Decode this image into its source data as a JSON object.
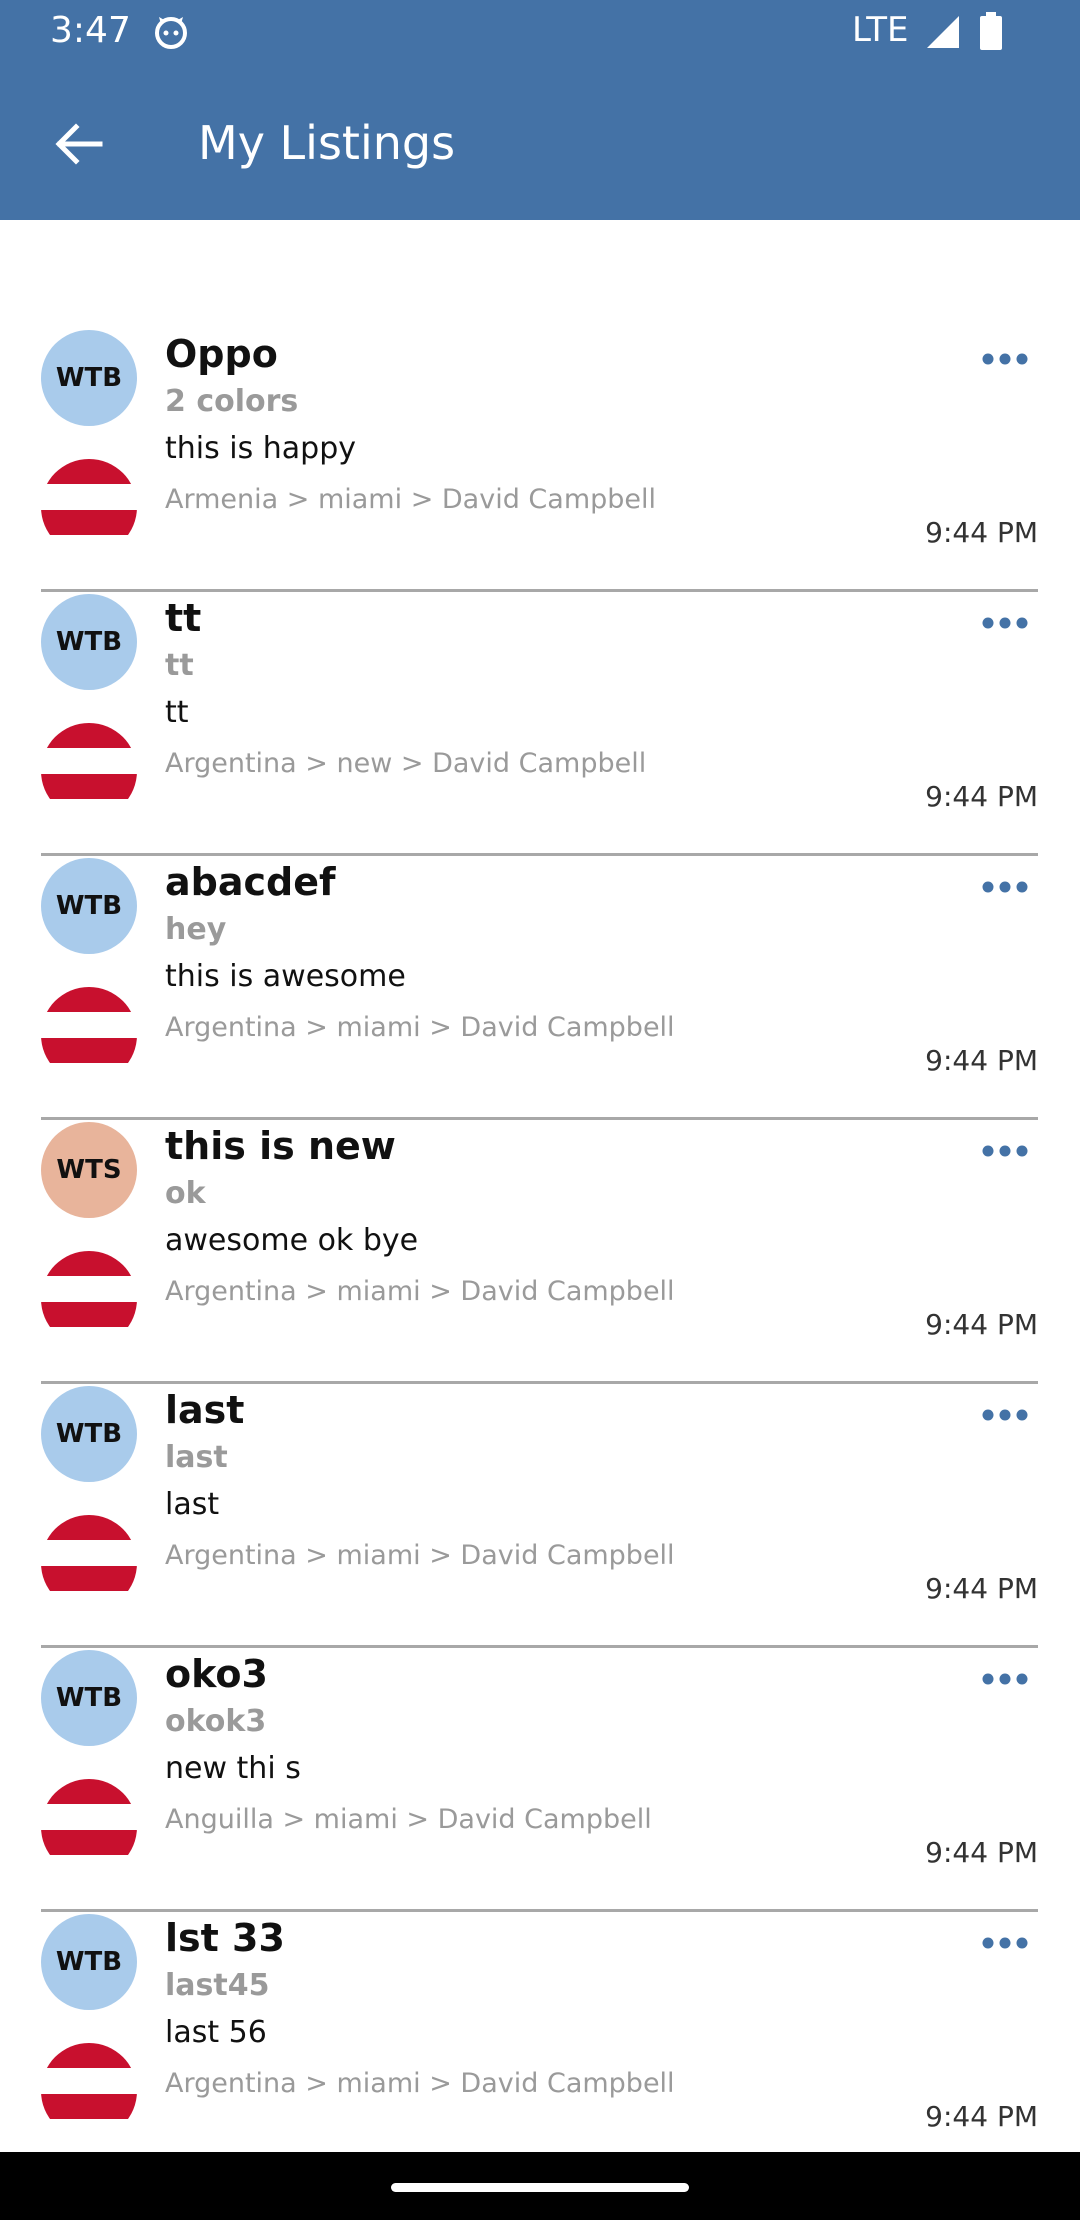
{
  "status_bar": {
    "time": "3:47",
    "network": "LTE"
  },
  "app_bar": {
    "title": "My Listings"
  },
  "colors": {
    "primary": "#4472a6",
    "wtb_badge": "#a9cbeb",
    "wts_badge": "#e8b49b",
    "flag_red": "#c8102e"
  },
  "listings": [
    {
      "badge": "WTB",
      "title": "Oppo",
      "subtitle": "2 colors",
      "description": "this is happy",
      "path": "Armenia > miami > David Campbell",
      "time": "9:44 PM"
    },
    {
      "badge": "WTB",
      "title": "tt",
      "subtitle": "tt",
      "description": "tt",
      "path": "Argentina > new > David Campbell",
      "time": "9:44 PM"
    },
    {
      "badge": "WTB",
      "title": "abacdef",
      "subtitle": "hey",
      "description": "this is awesome",
      "path": "Argentina > miami > David Campbell",
      "time": "9:44 PM"
    },
    {
      "badge": "WTS",
      "title": "this is new",
      "subtitle": "ok",
      "description": "awesome ok bye",
      "path": "Argentina > miami > David Campbell",
      "time": "9:44 PM"
    },
    {
      "badge": "WTB",
      "title": "last",
      "subtitle": "last",
      "description": "last",
      "path": "Argentina > miami > David Campbell",
      "time": "9:44 PM"
    },
    {
      "badge": "WTB",
      "title": "oko3",
      "subtitle": "okok3",
      "description": "new thi s",
      "path": "Anguilla > miami > David Campbell",
      "time": "9:44 PM"
    },
    {
      "badge": "WTB",
      "title": "lst 33",
      "subtitle": "last45",
      "description": "last 56",
      "path": "Argentina > miami > David Campbell",
      "time": "9:44 PM"
    }
  ]
}
